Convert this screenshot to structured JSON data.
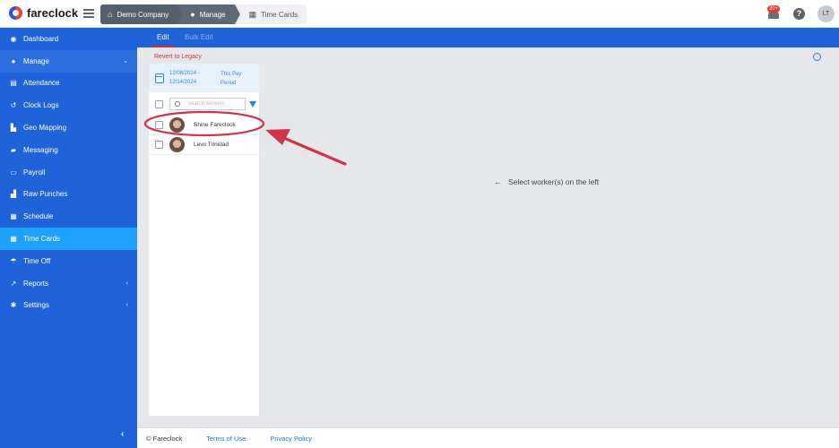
{
  "brand": {
    "name": "fareclock"
  },
  "breadcrumbs": [
    {
      "label": "Demo Company",
      "icon": "home-icon"
    },
    {
      "label": "Manage",
      "icon": "person-icon"
    },
    {
      "label": "Time Cards",
      "icon": "table-icon"
    }
  ],
  "topbar": {
    "notification_count": "30+",
    "help": "?",
    "avatar_initials": "LT"
  },
  "sidebar": {
    "items": [
      {
        "label": "Dashboard",
        "icon": "dashboard-icon"
      },
      {
        "label": "Manage",
        "icon": "person-icon"
      },
      {
        "label": "Attendance",
        "icon": "attendance-icon"
      },
      {
        "label": "Clock Logs",
        "icon": "history-icon"
      },
      {
        "label": "Geo Mapping",
        "icon": "map-icon"
      },
      {
        "label": "Messaging",
        "icon": "chat-icon"
      },
      {
        "label": "Payroll",
        "icon": "payroll-icon"
      },
      {
        "label": "Raw Punches",
        "icon": "car-icon"
      },
      {
        "label": "Schedule",
        "icon": "calendar-icon"
      },
      {
        "label": "Time Cards",
        "icon": "table-icon"
      },
      {
        "label": "Time Off",
        "icon": "umbrella-icon"
      },
      {
        "label": "Reports",
        "icon": "chart-icon"
      },
      {
        "label": "Settings",
        "icon": "gear-icon"
      }
    ],
    "active": "Time Cards"
  },
  "tabs": {
    "edit": "Edit",
    "bulk_edit": "Bulk Edit"
  },
  "revert_link": "Revert to Legacy",
  "period": {
    "start": "12/08/2024 -",
    "end": "12/14/2024",
    "label_line1": "This Pay",
    "label_line2": "Period"
  },
  "search": {
    "placeholder": "Search workers"
  },
  "workers": [
    {
      "name": "Shine Fareclock"
    },
    {
      "name": "Levo Trinidad"
    }
  ],
  "main": {
    "empty_message": "Select worker(s) on the left"
  },
  "footer": {
    "copyright": "© Fareclock",
    "terms": "Terms of Use",
    "privacy": "Privacy Policy"
  },
  "annotation": {
    "color": "#d0344a"
  }
}
